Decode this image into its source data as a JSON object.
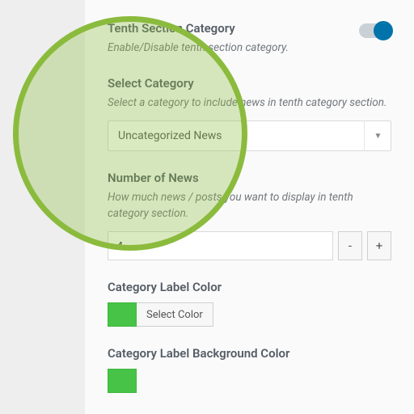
{
  "fields": {
    "toggle": {
      "title": "Tenth Section Category",
      "desc": "Enable/Disable tenth section category."
    },
    "select_cat": {
      "title": "Select Category",
      "desc": "Select a category to include news in tenth category section.",
      "value": "Uncategorized News"
    },
    "num_news": {
      "title": "Number of News",
      "desc": "How much news / posts you want to display in tenth category section.",
      "value": "4",
      "minus": "-",
      "plus": "+"
    },
    "label_color": {
      "title": "Category Label Color",
      "btn": "Select Color",
      "swatch": "#47c447"
    },
    "label_bg": {
      "title": "Category Label Background Color",
      "swatch": "#47c447"
    }
  }
}
